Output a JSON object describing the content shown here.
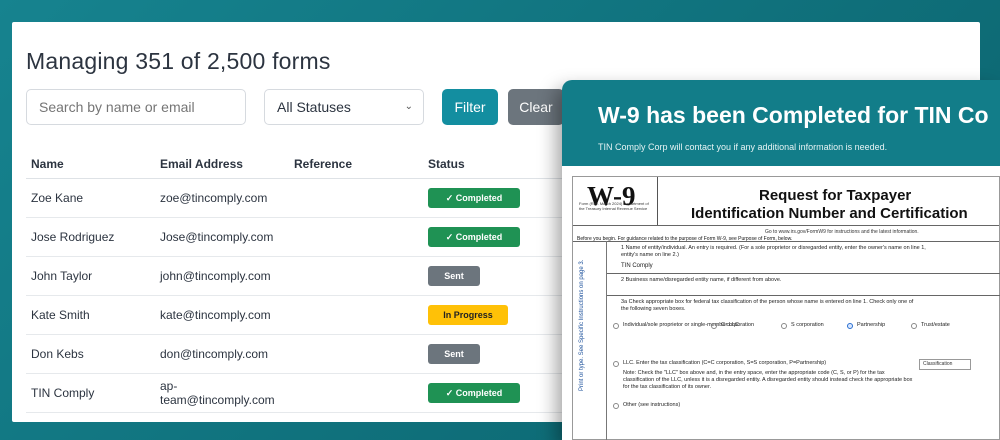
{
  "header": {
    "title": "Managing 351 of 2,500 forms"
  },
  "filters": {
    "search_placeholder": "Search by name or email",
    "status_selected": "All Statuses",
    "filter_label": "Filter",
    "clear_label": "Clear"
  },
  "table": {
    "columns": [
      "Name",
      "Email Address",
      "Reference",
      "Status"
    ],
    "rows": [
      {
        "name": "Zoe Kane",
        "email": "zoe@tincomply.com",
        "reference": "",
        "status": "✓ Completed"
      },
      {
        "name": "Jose Rodriguez",
        "email": "Jose@tincomply.com",
        "reference": "",
        "status": "✓ Completed"
      },
      {
        "name": "John Taylor",
        "email": "john@tincomply.com",
        "reference": "",
        "status": "Sent"
      },
      {
        "name": "Kate Smith",
        "email": "kate@tincomply.com",
        "reference": "",
        "status": "In Progress"
      },
      {
        "name": "Don Kebs",
        "email": "don@tincomply.com",
        "reference": "",
        "status": "Sent"
      },
      {
        "name": "TIN Comply",
        "email_line1": "ap-",
        "email_line2": "team@tincomply.com",
        "reference": "",
        "status": "✓ Completed"
      }
    ]
  },
  "overlay": {
    "title": "W-9 has been Completed for TIN Co",
    "subtitle": "TIN Comply Corp will contact you if any additional information is needed."
  },
  "w9": {
    "logo": "W-9",
    "form_meta": "Form\n(Rev. March 2024)\nDepartment of the Treasury\nInternal Revenue Service",
    "title_line1": "Request for Taxpayer",
    "title_line2": "Identification Number and Certification",
    "goto_text": "Go to www.irs.gov/FormW9 for instructions and the latest information.",
    "before_text": "Before you begin. For guidance related to the purpose of Form W-9, see Purpose of Form, below.",
    "line1_label": "1 Name of entity/individual. An entry is required. (For a sole proprietor or disregarded entity, enter the owner's name on line 1,",
    "line1_label_b": "entity's name on line 2.)",
    "line1_value": "TIN Comply",
    "line2_label": "2 Business name/disregarded entity name, if different from above.",
    "line3a_label": "3a Check appropriate box for federal tax classification of the person whose name is entered on line 1. Check only one of",
    "line3a_label_b": "the following seven boxes.",
    "options": [
      "Individual/sole proprietor or single-member LLC",
      "C corporation",
      "S corporation",
      "Partnership",
      "Trust/estate"
    ],
    "llc_label": "LLC. Enter the tax classification (C=C corporation, S=S corporation, P=Partnership)",
    "classification": "Classification",
    "note_text": "Note: Check the \"LLC\" box above and, in the entry space, enter the appropriate code (C, S, or P) for the tax",
    "note_text_b": "classification of the LLC, unless it is a disregarded entity. A disregarded entity should instead check the appropriate box",
    "note_text_c": "for the tax classification of its owner.",
    "other_label": "Other (see instructions)",
    "side_label": "Print or type. See Specific Instructions on page 3."
  },
  "colors": {
    "background": "#127a85",
    "accent": "#138ea0",
    "completed": "#1f9254",
    "sent": "#6c757d",
    "in_progress": "#ffc107"
  }
}
